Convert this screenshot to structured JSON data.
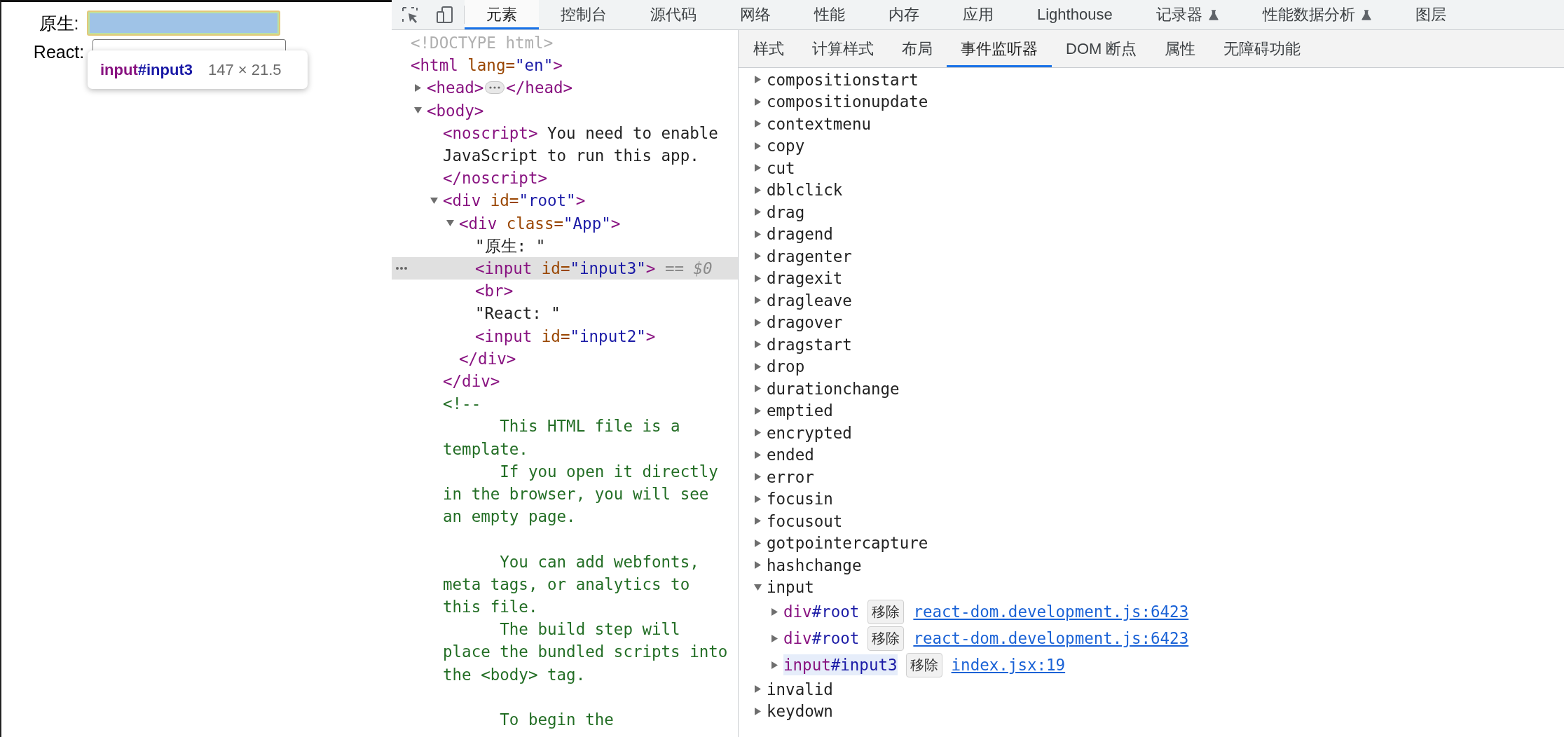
{
  "page": {
    "fields": [
      {
        "label": "原生:",
        "highlighted": true
      },
      {
        "label": "React:",
        "highlighted": false
      }
    ],
    "tooltip": {
      "tag": "input",
      "id": "#input3",
      "size": "147 × 21.5"
    }
  },
  "devtools": {
    "tabs": [
      {
        "label": "元素",
        "selected": true,
        "experimental": false
      },
      {
        "label": "控制台",
        "selected": false,
        "experimental": false
      },
      {
        "label": "源代码",
        "selected": false,
        "experimental": false
      },
      {
        "label": "网络",
        "selected": false,
        "experimental": false
      },
      {
        "label": "性能",
        "selected": false,
        "experimental": false
      },
      {
        "label": "内存",
        "selected": false,
        "experimental": false
      },
      {
        "label": "应用",
        "selected": false,
        "experimental": false
      },
      {
        "label": "Lighthouse",
        "selected": false,
        "experimental": false
      },
      {
        "label": "记录器",
        "selected": false,
        "experimental": true
      },
      {
        "label": "性能数据分析",
        "selected": false,
        "experimental": true
      },
      {
        "label": "图层",
        "selected": false,
        "experimental": false
      }
    ],
    "dom_tree": [
      {
        "selected": false,
        "tokens": [
          {
            "kind": "doctype",
            "text": "<!DOCTYPE html>"
          }
        ]
      },
      {
        "selected": false,
        "tokens": [
          {
            "kind": "tag",
            "text": "<html"
          },
          {
            "kind": "attr",
            "text": " lang="
          },
          {
            "kind": "value",
            "text": "\"en\""
          },
          {
            "kind": "tag",
            "text": ">"
          }
        ],
        "children": [
          {
            "selected": false,
            "expanded": false,
            "tokens": [
              {
                "kind": "tag",
                "text": "<head>"
              },
              {
                "kind": "collapsed"
              },
              {
                "kind": "tag",
                "text": "</head>"
              }
            ]
          },
          {
            "selected": false,
            "expanded": true,
            "tokens": [
              {
                "kind": "tag",
                "text": "<body>"
              }
            ],
            "children": [
              {
                "selected": false,
                "tokens": [
                  {
                    "kind": "tag",
                    "text": "<noscript>"
                  },
                  {
                    "kind": "text",
                    "text": " You need to enable JavaScript to run this app."
                  }
                ],
                "close": [
                  {
                    "kind": "tag",
                    "text": "</noscript>"
                  }
                ]
              },
              {
                "selected": false,
                "expanded": true,
                "tokens": [
                  {
                    "kind": "tag",
                    "text": "<div"
                  },
                  {
                    "kind": "attr",
                    "text": " id="
                  },
                  {
                    "kind": "value",
                    "text": "\"root\""
                  },
                  {
                    "kind": "tag",
                    "text": ">"
                  }
                ],
                "close": [
                  {
                    "kind": "tag",
                    "text": "</div>"
                  }
                ],
                "children": [
                  {
                    "selected": false,
                    "expanded": true,
                    "tokens": [
                      {
                        "kind": "tag",
                        "text": "<div"
                      },
                      {
                        "kind": "attr",
                        "text": " class="
                      },
                      {
                        "kind": "value",
                        "text": "\"App\""
                      },
                      {
                        "kind": "tag",
                        "text": ">"
                      }
                    ],
                    "close": [
                      {
                        "kind": "tag",
                        "text": "</div>"
                      }
                    ],
                    "children": [
                      {
                        "selected": false,
                        "tokens": [
                          {
                            "kind": "text",
                            "text": "\"原生: \""
                          }
                        ]
                      },
                      {
                        "selected": true,
                        "tokens": [
                          {
                            "kind": "tag",
                            "text": "<input"
                          },
                          {
                            "kind": "attr",
                            "text": " id="
                          },
                          {
                            "kind": "value",
                            "text": "\"input3\""
                          },
                          {
                            "kind": "tag",
                            "text": ">"
                          },
                          {
                            "kind": "ref",
                            "text": " == $0"
                          }
                        ]
                      },
                      {
                        "selected": false,
                        "tokens": [
                          {
                            "kind": "tag",
                            "text": "<br>"
                          }
                        ]
                      },
                      {
                        "selected": false,
                        "tokens": [
                          {
                            "kind": "text",
                            "text": "\"React: \""
                          }
                        ]
                      },
                      {
                        "selected": false,
                        "tokens": [
                          {
                            "kind": "tag",
                            "text": "<input"
                          },
                          {
                            "kind": "attr",
                            "text": " id="
                          },
                          {
                            "kind": "value",
                            "text": "\"input2\""
                          },
                          {
                            "kind": "tag",
                            "text": ">"
                          }
                        ]
                      }
                    ]
                  }
                ]
              },
              {
                "selected": false,
                "tokens": [
                  {
                    "kind": "comment",
                    "text": "<!--\n      This HTML file is a template.\n      If you open it directly in the browser, you will see an empty page.\n\n      You can add webfonts, meta tags, or analytics to this file.\n      The build step will place the bundled scripts into the <body> tag.\n\n      To begin the"
                  }
                ]
              }
            ]
          }
        ]
      }
    ],
    "sidebar_tabs": [
      {
        "label": "样式",
        "selected": false
      },
      {
        "label": "计算样式",
        "selected": false
      },
      {
        "label": "布局",
        "selected": false
      },
      {
        "label": "事件监听器",
        "selected": true
      },
      {
        "label": "DOM 断点",
        "selected": false
      },
      {
        "label": "属性",
        "selected": false
      },
      {
        "label": "无障碍功能",
        "selected": false
      }
    ],
    "events": [
      {
        "name": "compositionstart",
        "expanded": false
      },
      {
        "name": "compositionupdate",
        "expanded": false
      },
      {
        "name": "contextmenu",
        "expanded": false
      },
      {
        "name": "copy",
        "expanded": false
      },
      {
        "name": "cut",
        "expanded": false
      },
      {
        "name": "dblclick",
        "expanded": false
      },
      {
        "name": "drag",
        "expanded": false
      },
      {
        "name": "dragend",
        "expanded": false
      },
      {
        "name": "dragenter",
        "expanded": false
      },
      {
        "name": "dragexit",
        "expanded": false
      },
      {
        "name": "dragleave",
        "expanded": false
      },
      {
        "name": "dragover",
        "expanded": false
      },
      {
        "name": "dragstart",
        "expanded": false
      },
      {
        "name": "drop",
        "expanded": false
      },
      {
        "name": "durationchange",
        "expanded": false
      },
      {
        "name": "emptied",
        "expanded": false
      },
      {
        "name": "encrypted",
        "expanded": false
      },
      {
        "name": "ended",
        "expanded": false
      },
      {
        "name": "error",
        "expanded": false
      },
      {
        "name": "focusin",
        "expanded": false
      },
      {
        "name": "focusout",
        "expanded": false
      },
      {
        "name": "gotpointercapture",
        "expanded": false
      },
      {
        "name": "hashchange",
        "expanded": false
      },
      {
        "name": "input",
        "expanded": true,
        "listeners": [
          {
            "tag": "div",
            "id": "#root",
            "remove": "移除",
            "source": "react-dom.development.js:6423",
            "expanded": false,
            "highlighted": false
          },
          {
            "tag": "div",
            "id": "#root",
            "remove": "移除",
            "source": "react-dom.development.js:6423",
            "expanded": false,
            "highlighted": false
          },
          {
            "tag": "input",
            "id": "#input3",
            "remove": "移除",
            "source": "index.jsx:19",
            "expanded": false,
            "highlighted": true
          }
        ]
      },
      {
        "name": "invalid",
        "expanded": false
      },
      {
        "name": "keydown",
        "expanded": false
      }
    ]
  }
}
